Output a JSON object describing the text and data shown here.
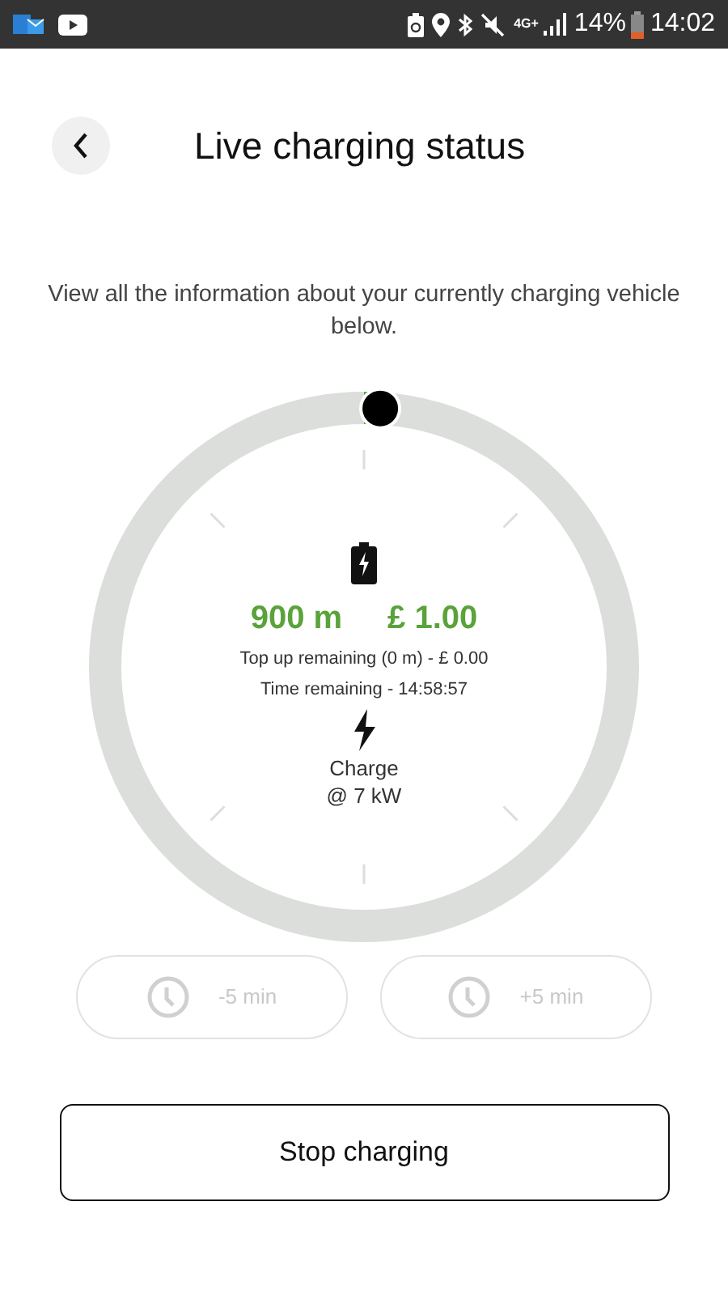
{
  "status_bar": {
    "network": "4G+",
    "battery": "14%",
    "time": "14:02"
  },
  "header": {
    "title": "Live charging status"
  },
  "description": "View all the information about your currently charging vehicle below.",
  "stats": {
    "distance": "900 m",
    "cost": "£ 1.00",
    "top_up": "Top up remaining (0 m) - £ 0.00",
    "time_remaining": "Time remaining - 14:58:57",
    "charge_label": "Charge",
    "power": "@ 7 kW"
  },
  "time_buttons": [
    {
      "label": "-5 min",
      "disabled": true
    },
    {
      "label": "+5 min",
      "disabled": true
    }
  ],
  "stop_button": {
    "label": "Stop charging"
  }
}
